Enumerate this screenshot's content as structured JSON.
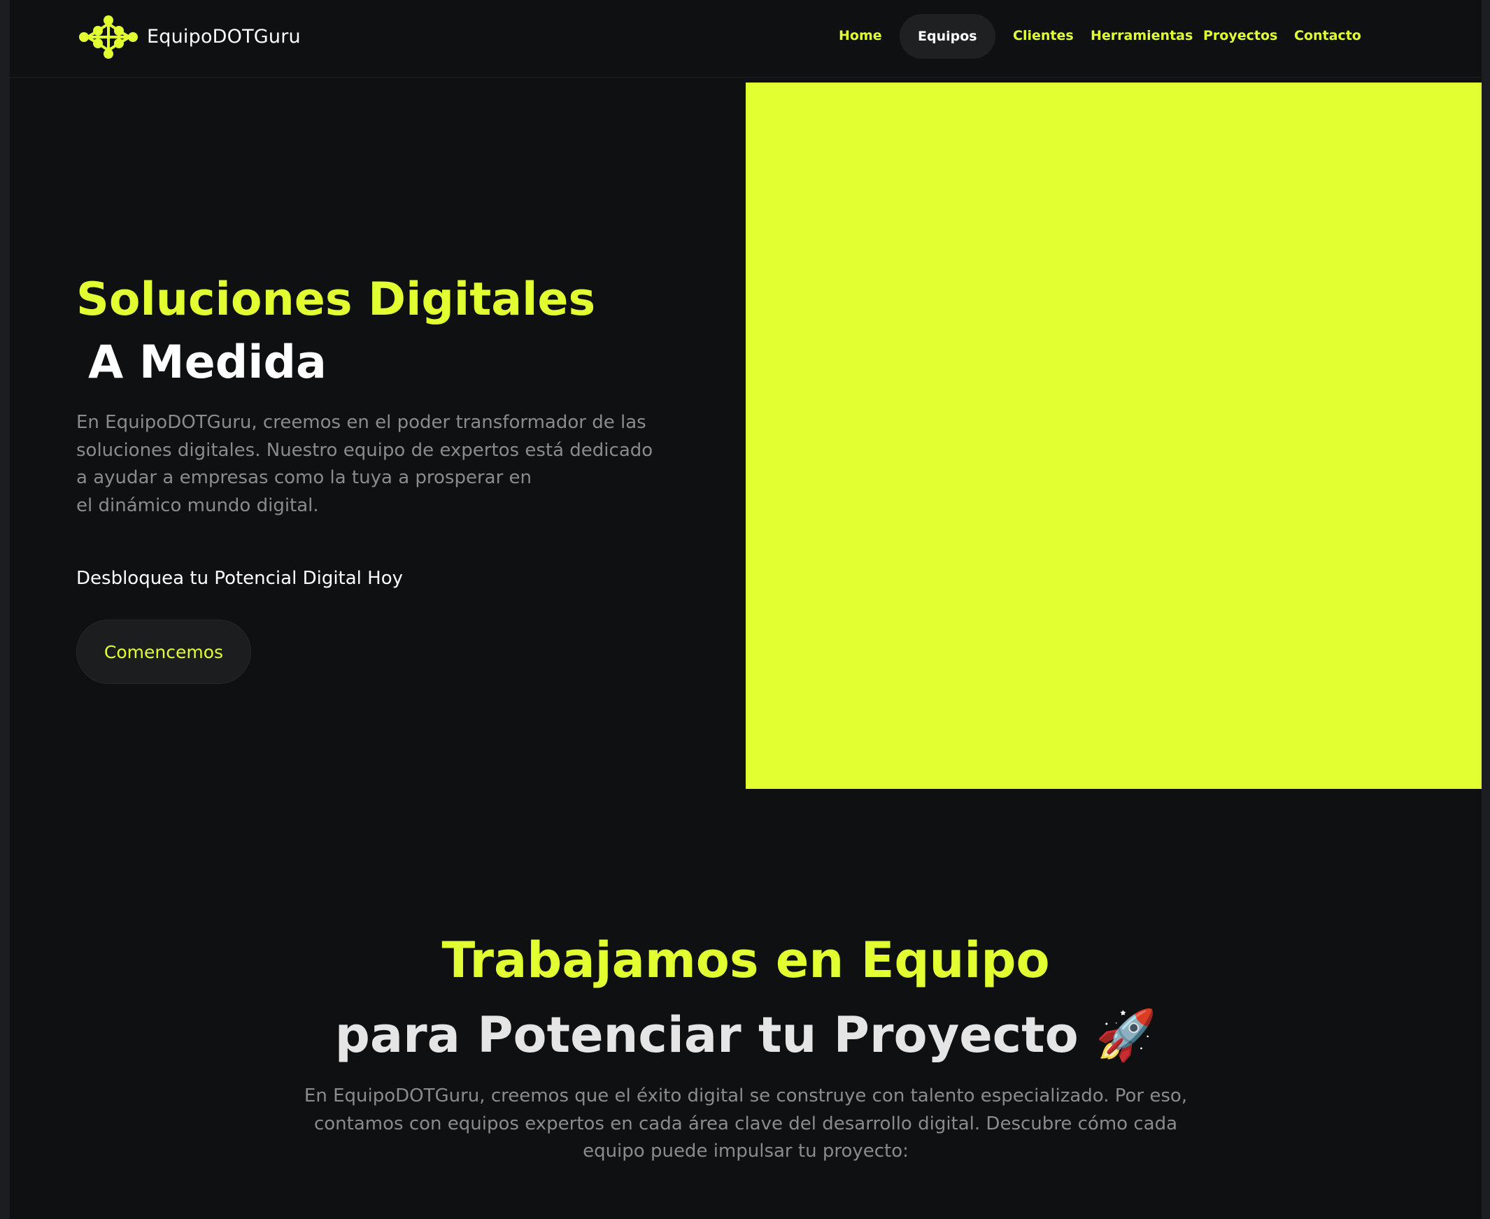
{
  "colors": {
    "accent": "#e2ff32",
    "background": "#0f1011",
    "muted_text": "#8b8b8e"
  },
  "header": {
    "logo_icon": "dots-logo-icon",
    "brand": "EquipoDOTGuru",
    "nav": [
      {
        "label": "Home",
        "active": false
      },
      {
        "label": "Equipos",
        "active": true
      },
      {
        "label": "Clientes",
        "active": false
      },
      {
        "label": "Herramientas",
        "active": false
      },
      {
        "label": "Proyectos",
        "active": false
      },
      {
        "label": "Contacto",
        "active": false
      }
    ]
  },
  "hero": {
    "title_line1": "Soluciones Digitales",
    "title_line2": "A Medida",
    "description": "En EquipoDOTGuru, creemos en el poder transformador de las soluciones digitales. Nuestro equipo de expertos está dedicado a ayudar a empresas como la tuya a prosperar en\n el dinámico mundo digital.",
    "cta_text": "Desbloquea tu Potencial Digital Hoy",
    "button_label": "Comencemos"
  },
  "teams_section": {
    "title_line1": "Trabajamos en Equipo",
    "title_line2": "para Potenciar tu Proyecto 🚀",
    "description": "En EquipoDOTGuru, creemos que el éxito digital se construye con talento especializado. Por eso, contamos con equipos expertos en cada área clave del desarrollo digital. Descubre cómo cada equipo puede impulsar tu proyecto:"
  }
}
